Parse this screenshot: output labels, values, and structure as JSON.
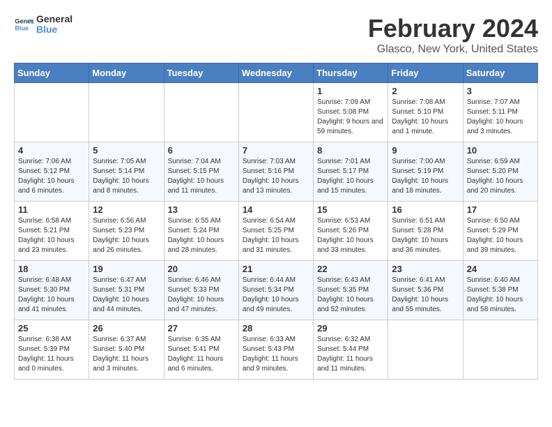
{
  "header": {
    "logo_text_general": "General",
    "logo_text_blue": "Blue",
    "title": "February 2024",
    "subtitle": "Glasco, New York, United States"
  },
  "days_of_week": [
    "Sunday",
    "Monday",
    "Tuesday",
    "Wednesday",
    "Thursday",
    "Friday",
    "Saturday"
  ],
  "weeks": [
    [
      {
        "day": "",
        "info": ""
      },
      {
        "day": "",
        "info": ""
      },
      {
        "day": "",
        "info": ""
      },
      {
        "day": "",
        "info": ""
      },
      {
        "day": "1",
        "info": "Sunrise: 7:09 AM\nSunset: 5:08 PM\nDaylight: 9 hours and 59 minutes."
      },
      {
        "day": "2",
        "info": "Sunrise: 7:08 AM\nSunset: 5:10 PM\nDaylight: 10 hours and 1 minute."
      },
      {
        "day": "3",
        "info": "Sunrise: 7:07 AM\nSunset: 5:11 PM\nDaylight: 10 hours and 3 minutes."
      }
    ],
    [
      {
        "day": "4",
        "info": "Sunrise: 7:06 AM\nSunset: 5:12 PM\nDaylight: 10 hours and 6 minutes."
      },
      {
        "day": "5",
        "info": "Sunrise: 7:05 AM\nSunset: 5:14 PM\nDaylight: 10 hours and 8 minutes."
      },
      {
        "day": "6",
        "info": "Sunrise: 7:04 AM\nSunset: 5:15 PM\nDaylight: 10 hours and 11 minutes."
      },
      {
        "day": "7",
        "info": "Sunrise: 7:03 AM\nSunset: 5:16 PM\nDaylight: 10 hours and 13 minutes."
      },
      {
        "day": "8",
        "info": "Sunrise: 7:01 AM\nSunset: 5:17 PM\nDaylight: 10 hours and 15 minutes."
      },
      {
        "day": "9",
        "info": "Sunrise: 7:00 AM\nSunset: 5:19 PM\nDaylight: 10 hours and 18 minutes."
      },
      {
        "day": "10",
        "info": "Sunrise: 6:59 AM\nSunset: 5:20 PM\nDaylight: 10 hours and 20 minutes."
      }
    ],
    [
      {
        "day": "11",
        "info": "Sunrise: 6:58 AM\nSunset: 5:21 PM\nDaylight: 10 hours and 23 minutes."
      },
      {
        "day": "12",
        "info": "Sunrise: 6:56 AM\nSunset: 5:23 PM\nDaylight: 10 hours and 26 minutes."
      },
      {
        "day": "13",
        "info": "Sunrise: 6:55 AM\nSunset: 5:24 PM\nDaylight: 10 hours and 28 minutes."
      },
      {
        "day": "14",
        "info": "Sunrise: 6:54 AM\nSunset: 5:25 PM\nDaylight: 10 hours and 31 minutes."
      },
      {
        "day": "15",
        "info": "Sunrise: 6:53 AM\nSunset: 5:26 PM\nDaylight: 10 hours and 33 minutes."
      },
      {
        "day": "16",
        "info": "Sunrise: 6:51 AM\nSunset: 5:28 PM\nDaylight: 10 hours and 36 minutes."
      },
      {
        "day": "17",
        "info": "Sunrise: 6:50 AM\nSunset: 5:29 PM\nDaylight: 10 hours and 39 minutes."
      }
    ],
    [
      {
        "day": "18",
        "info": "Sunrise: 6:48 AM\nSunset: 5:30 PM\nDaylight: 10 hours and 41 minutes."
      },
      {
        "day": "19",
        "info": "Sunrise: 6:47 AM\nSunset: 5:31 PM\nDaylight: 10 hours and 44 minutes."
      },
      {
        "day": "20",
        "info": "Sunrise: 6:46 AM\nSunset: 5:33 PM\nDaylight: 10 hours and 47 minutes."
      },
      {
        "day": "21",
        "info": "Sunrise: 6:44 AM\nSunset: 5:34 PM\nDaylight: 10 hours and 49 minutes."
      },
      {
        "day": "22",
        "info": "Sunrise: 6:43 AM\nSunset: 5:35 PM\nDaylight: 10 hours and 52 minutes."
      },
      {
        "day": "23",
        "info": "Sunrise: 6:41 AM\nSunset: 5:36 PM\nDaylight: 10 hours and 55 minutes."
      },
      {
        "day": "24",
        "info": "Sunrise: 6:40 AM\nSunset: 5:38 PM\nDaylight: 10 hours and 58 minutes."
      }
    ],
    [
      {
        "day": "25",
        "info": "Sunrise: 6:38 AM\nSunset: 5:39 PM\nDaylight: 11 hours and 0 minutes."
      },
      {
        "day": "26",
        "info": "Sunrise: 6:37 AM\nSunset: 5:40 PM\nDaylight: 11 hours and 3 minutes."
      },
      {
        "day": "27",
        "info": "Sunrise: 6:35 AM\nSunset: 5:41 PM\nDaylight: 11 hours and 6 minutes."
      },
      {
        "day": "28",
        "info": "Sunrise: 6:33 AM\nSunset: 5:43 PM\nDaylight: 11 hours and 9 minutes."
      },
      {
        "day": "29",
        "info": "Sunrise: 6:32 AM\nSunset: 5:44 PM\nDaylight: 11 hours and 11 minutes."
      },
      {
        "day": "",
        "info": ""
      },
      {
        "day": "",
        "info": ""
      }
    ]
  ]
}
